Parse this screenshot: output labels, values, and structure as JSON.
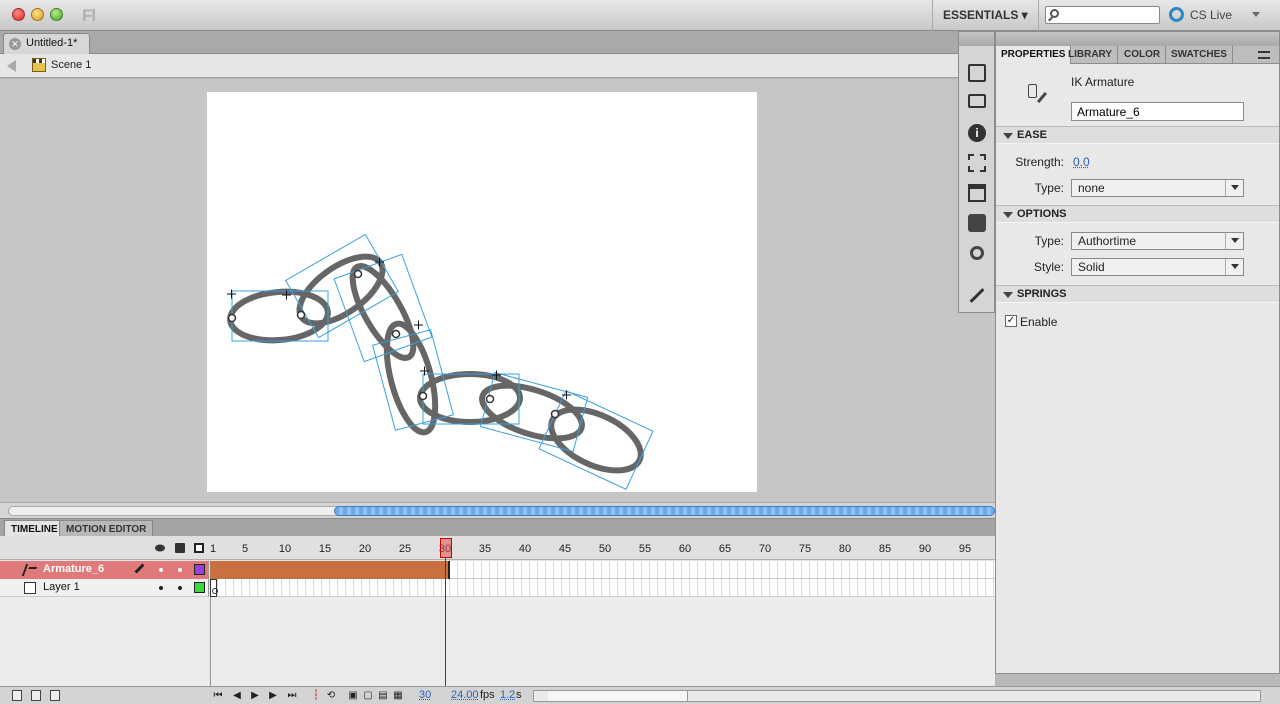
{
  "window": {
    "app_logo": "Fl",
    "workspace_label": "ESSENTIALS ▾",
    "cs_live_label": "CS Live"
  },
  "document": {
    "tab_title": "Untitled-1*",
    "close_glyph": "✕",
    "scene_label": "Scene 1"
  },
  "timeline": {
    "tabs": [
      "TIMELINE",
      "MOTION EDITOR"
    ],
    "ruler": [
      "1",
      "5",
      "10",
      "15",
      "20",
      "25",
      "30",
      "35",
      "40",
      "45",
      "50",
      "55",
      "60",
      "65",
      "70",
      "75",
      "80",
      "85",
      "90",
      "95"
    ],
    "current_frame_value": 30,
    "layers": [
      {
        "name": "Armature_6",
        "swatch_color": "#9b3fd6",
        "selected": true
      },
      {
        "name": "Layer 1",
        "swatch_color": "#3fd63f",
        "selected": false
      }
    ],
    "footer": {
      "current_frame": "30",
      "fps": "24.00",
      "fps_unit": "fps",
      "elapsed": "1.2",
      "elapsed_unit": "s"
    }
  },
  "properties": {
    "tabs": [
      "PROPERTIES",
      "LIBRARY",
      "COLOR",
      "SWATCHES"
    ],
    "object_type": "IK Armature",
    "instance_name": "Armature_6",
    "sections": {
      "ease": {
        "title": "EASE",
        "strength_label": "Strength:",
        "strength_value": "0.0",
        "type_label": "Type:",
        "type_value": "none"
      },
      "options": {
        "title": "OPTIONS",
        "type_label": "Type:",
        "type_value": "Authortime",
        "style_label": "Style:",
        "style_value": "Solid"
      },
      "springs": {
        "title": "SPRINGS",
        "enable_label": "Enable",
        "enable_checked": true
      }
    }
  },
  "colors": {
    "selected_layer_bg": "#e07a7a",
    "pose_span": "#c8703e",
    "bone_outline": "#3aa0e0",
    "chain_link": "#666666"
  }
}
